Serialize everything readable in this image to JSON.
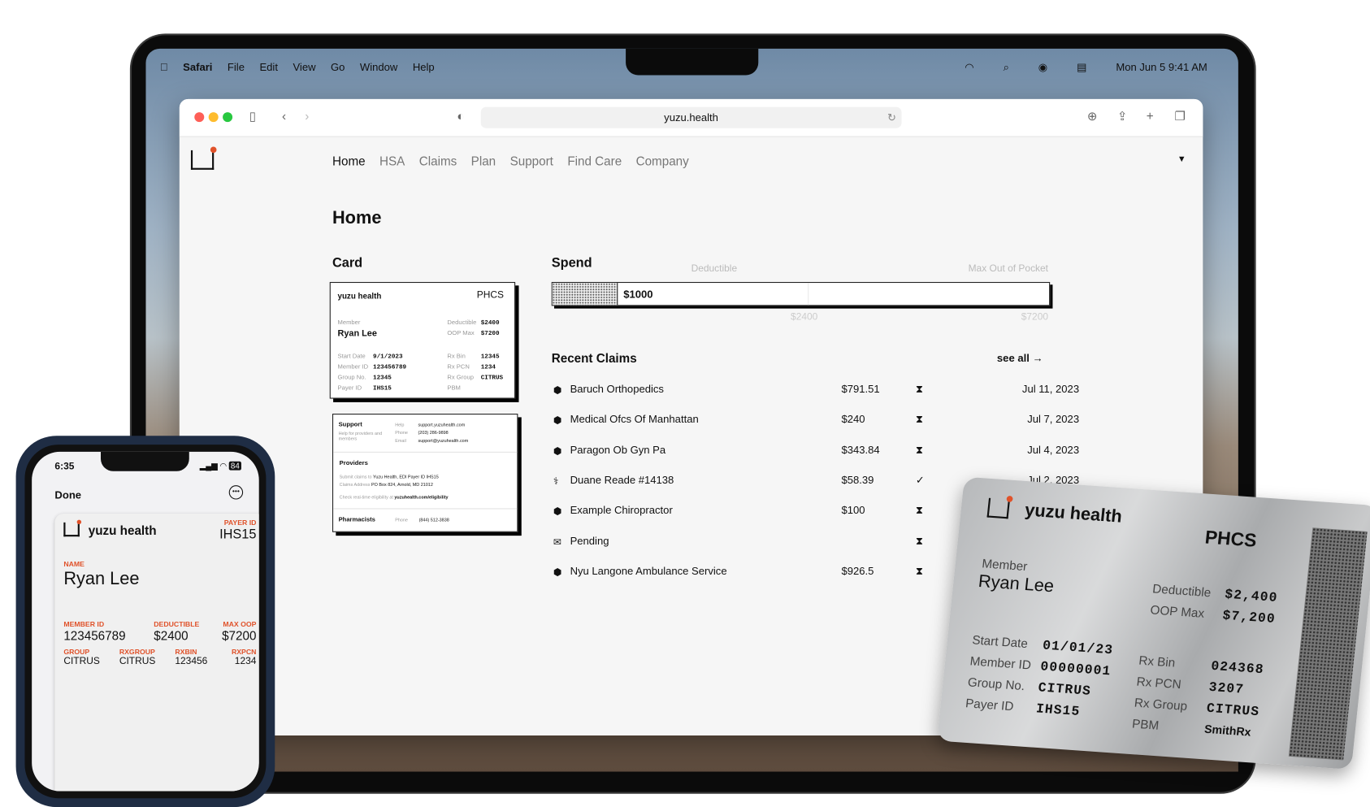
{
  "menubar": {
    "app": "Safari",
    "items": [
      "File",
      "Edit",
      "View",
      "Go",
      "Window",
      "Help"
    ],
    "datetime": "Mon Jun 5  9:41 AM"
  },
  "browser": {
    "url": "yuzu.health"
  },
  "nav": {
    "items": [
      "Home",
      "HSA",
      "Claims",
      "Plan",
      "Support",
      "Find Care",
      "Company"
    ]
  },
  "page": {
    "title": "Home",
    "card_heading": "Card",
    "spend_heading": "Spend",
    "claims_heading": "Recent Claims",
    "see_all": "see all →"
  },
  "card": {
    "brand": "yuzu health",
    "network": "PHCS",
    "member_label": "Member",
    "member": "Ryan Lee",
    "left": [
      {
        "k": "Start Date",
        "v": "9/1/2023"
      },
      {
        "k": "Member ID",
        "v": "123456789"
      },
      {
        "k": "Group No.",
        "v": "12345"
      },
      {
        "k": "Payer ID",
        "v": "IHS15"
      }
    ],
    "top_right": [
      {
        "k": "Deductible",
        "v": "$2400"
      },
      {
        "k": "OOP Max",
        "v": "$7200"
      }
    ],
    "right": [
      {
        "k": "Rx Bin",
        "v": "12345"
      },
      {
        "k": "Rx PCN",
        "v": "1234"
      },
      {
        "k": "Rx Group",
        "v": "CITRUS"
      },
      {
        "k": "PBM",
        "v": ""
      }
    ]
  },
  "card_back": {
    "support": "Support",
    "support_sub": "Help for providers and members",
    "help_label": "Help",
    "help": "support.yuzuhealth.com",
    "phone_label": "Phone",
    "phone": "(203) 286-9898",
    "email_label": "Email",
    "email": "support@yuzuhealth.com",
    "providers": "Providers",
    "submit_label": "Submit claims to",
    "submit": "Yuzu Health, EDI Payer ID IHS15",
    "address_label": "Claims Address",
    "address": "PO Box 824, Arnold, MD 21012",
    "elig_label": "Check real-time eligibility at",
    "elig": "yuzuhealth.com/eligibility",
    "pharm": "Pharmacists",
    "pharm_phone_label": "Phone",
    "pharm_phone": "(844) 512-3838"
  },
  "spend": {
    "spent": 1000,
    "spent_label": "$1000",
    "deductible": 2400,
    "oop_max": 7200,
    "deductible_label": "Deductible",
    "oop_label": "Max Out of Pocket",
    "deductible_value": "$2400",
    "oop_value": "$7200"
  },
  "claims": [
    {
      "icon": "shield",
      "name": "Baruch Orthopedics",
      "amount": "$791.51",
      "status": "pending",
      "date": "Jul 11, 2023"
    },
    {
      "icon": "shield",
      "name": "Medical Ofcs Of Manhattan",
      "amount": "$240",
      "status": "pending",
      "date": "Jul 7, 2023"
    },
    {
      "icon": "shield",
      "name": "Paragon Ob Gyn Pa",
      "amount": "$343.84",
      "status": "pending",
      "date": "Jul 4, 2023"
    },
    {
      "icon": "pharmacy",
      "name": "Duane Reade #14138",
      "amount": "$58.39",
      "status": "done",
      "date": "Jul 2, 2023"
    },
    {
      "icon": "shield",
      "name": "Example Chiropractor",
      "amount": "$100",
      "status": "pending",
      "date": ""
    },
    {
      "icon": "mail",
      "name": "Pending",
      "amount": "",
      "status": "pending",
      "date": ""
    },
    {
      "icon": "shield",
      "name": "Nyu Langone Ambulance Service",
      "amount": "$926.5",
      "status": "pending",
      "date": ""
    }
  ],
  "phone": {
    "time": "6:35",
    "battery": "84",
    "done": "Done",
    "brand": "yuzu health",
    "payer_label": "PAYER ID",
    "payer": "IHS15",
    "name_label": "NAME",
    "name": "Ryan Lee",
    "f1": [
      {
        "k": "MEMBER ID",
        "v": "123456789"
      },
      {
        "k": "DEDUCTIBLE",
        "v": "$2400"
      },
      {
        "k": "MAX OOP",
        "v": "$7200"
      }
    ],
    "f2": [
      {
        "k": "GROUP",
        "v": "CITRUS"
      },
      {
        "k": "RXGROUP",
        "v": "CITRUS"
      },
      {
        "k": "RXBIN",
        "v": "123456"
      },
      {
        "k": "RXPCN",
        "v": "1234"
      }
    ]
  },
  "metal": {
    "brand": "yuzu health",
    "network": "PHCS",
    "member_label": "Member",
    "member": "Ryan Lee",
    "top_right": [
      {
        "k": "Deductible",
        "v": "$2,400"
      },
      {
        "k": "OOP Max",
        "v": "$7,200"
      }
    ],
    "left": [
      {
        "k": "Start Date",
        "v": "01/01/23"
      },
      {
        "k": "Member ID",
        "v": "00000001"
      },
      {
        "k": "Group No.",
        "v": "CITRUS"
      },
      {
        "k": "Payer ID",
        "v": "IHS15"
      }
    ],
    "right": [
      {
        "k": "Rx Bin",
        "v": "024368"
      },
      {
        "k": "Rx PCN",
        "v": "3207"
      },
      {
        "k": "Rx Group",
        "v": "CITRUS"
      },
      {
        "k": "PBM",
        "v": "SmithRx"
      }
    ]
  },
  "colors": {
    "accent": "#e0522a"
  }
}
